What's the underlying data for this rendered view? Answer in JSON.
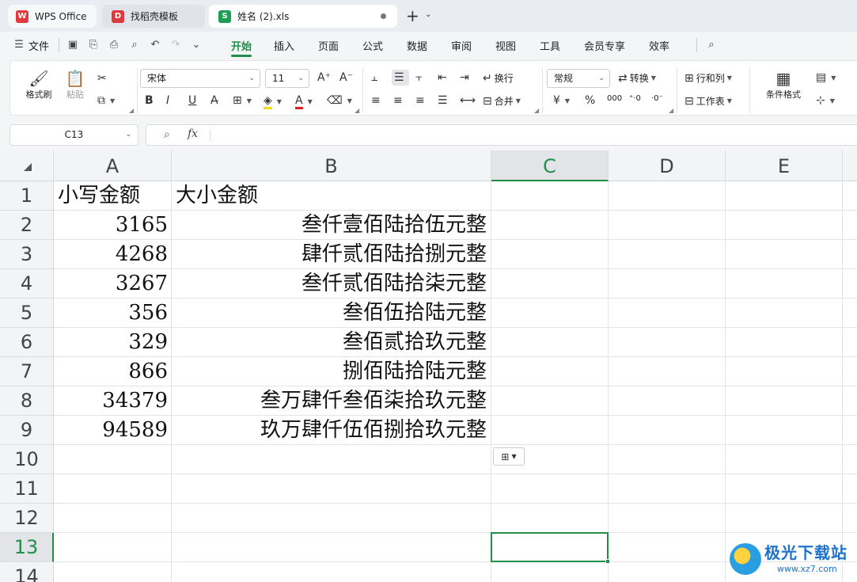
{
  "tabs": {
    "wps": "WPS Office",
    "template": "找稻壳模板",
    "doc": "姓名 (2).xls"
  },
  "menu": {
    "file": "文件",
    "items": [
      "开始",
      "插入",
      "页面",
      "公式",
      "数据",
      "审阅",
      "视图",
      "工具",
      "会员专享",
      "效率"
    ]
  },
  "ribbon": {
    "format_painter": "格式刷",
    "paste": "粘贴",
    "font_name": "宋体",
    "font_size": "11",
    "wrap": "换行",
    "merge": "合并",
    "number_format": "常规",
    "convert": "转换",
    "rows_cols": "行和列",
    "worksheet": "工作表",
    "cond_format": "条件格式",
    "pct": "%",
    "thousands": "000"
  },
  "formula_bar": {
    "cell_ref": "C13",
    "fx": "fx"
  },
  "sheet": {
    "columns": [
      "A",
      "B",
      "C",
      "D",
      "E"
    ],
    "rows": [
      "1",
      "2",
      "3",
      "4",
      "5",
      "6",
      "7",
      "8",
      "9",
      "10",
      "11",
      "12",
      "13",
      "14"
    ],
    "header_a": "小写金额",
    "header_b": "大小金额",
    "data": [
      {
        "a": "3165",
        "b": "叁仟壹佰陆拾伍元整"
      },
      {
        "a": "4268",
        "b": "肆仟贰佰陆拾捌元整"
      },
      {
        "a": "3267",
        "b": "叁仟贰佰陆拾柒元整"
      },
      {
        "a": "356",
        "b": "叁佰伍拾陆元整"
      },
      {
        "a": "329",
        "b": "叁佰贰拾玖元整"
      },
      {
        "a": "866",
        "b": "捌佰陆拾陆元整"
      },
      {
        "a": "34379",
        "b": "叁万肆仟叁佰柒拾玖元整"
      },
      {
        "a": "94589",
        "b": "玖万肆仟伍佰捌拾玖元整"
      }
    ]
  },
  "watermark": {
    "brand": "极光下载站",
    "url": "www.xz7.com"
  },
  "colors": {
    "accent": "#1f8f4a",
    "wps_red": "#e0393e",
    "sheet_green": "#1f9d55"
  }
}
